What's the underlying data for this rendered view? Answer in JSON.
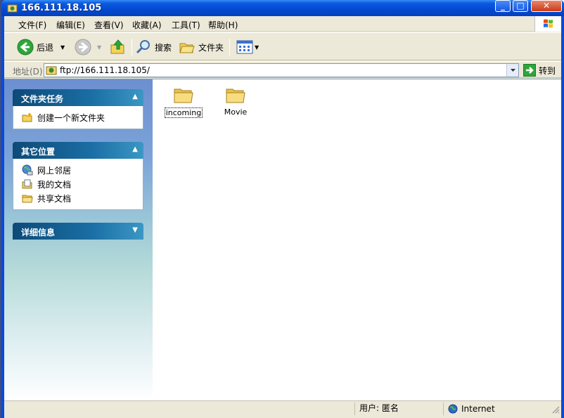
{
  "window": {
    "title": "166.111.18.105"
  },
  "menubar": {
    "items": [
      "文件(F)",
      "编辑(E)",
      "查看(V)",
      "收藏(A)",
      "工具(T)",
      "帮助(H)"
    ]
  },
  "toolbar": {
    "back_label": "后退",
    "search_label": "搜索",
    "folders_label": "文件夹"
  },
  "addressbar": {
    "label": "地址(D)",
    "value": "ftp://166.111.18.105/",
    "go_label": "转到"
  },
  "taskpane": {
    "file_tasks": {
      "title": "文件夹任务",
      "items": [
        "创建一个新文件夹"
      ]
    },
    "other_places": {
      "title": "其它位置",
      "items": [
        "网上邻居",
        "我的文档",
        "共享文档"
      ]
    },
    "details": {
      "title": "详细信息"
    }
  },
  "content": {
    "files": [
      {
        "name": "incoming",
        "type": "folder",
        "selected": true
      },
      {
        "name": "Movie",
        "type": "folder",
        "selected": false
      }
    ]
  },
  "statusbar": {
    "user": "用户: 匿名",
    "zone": "Internet"
  }
}
